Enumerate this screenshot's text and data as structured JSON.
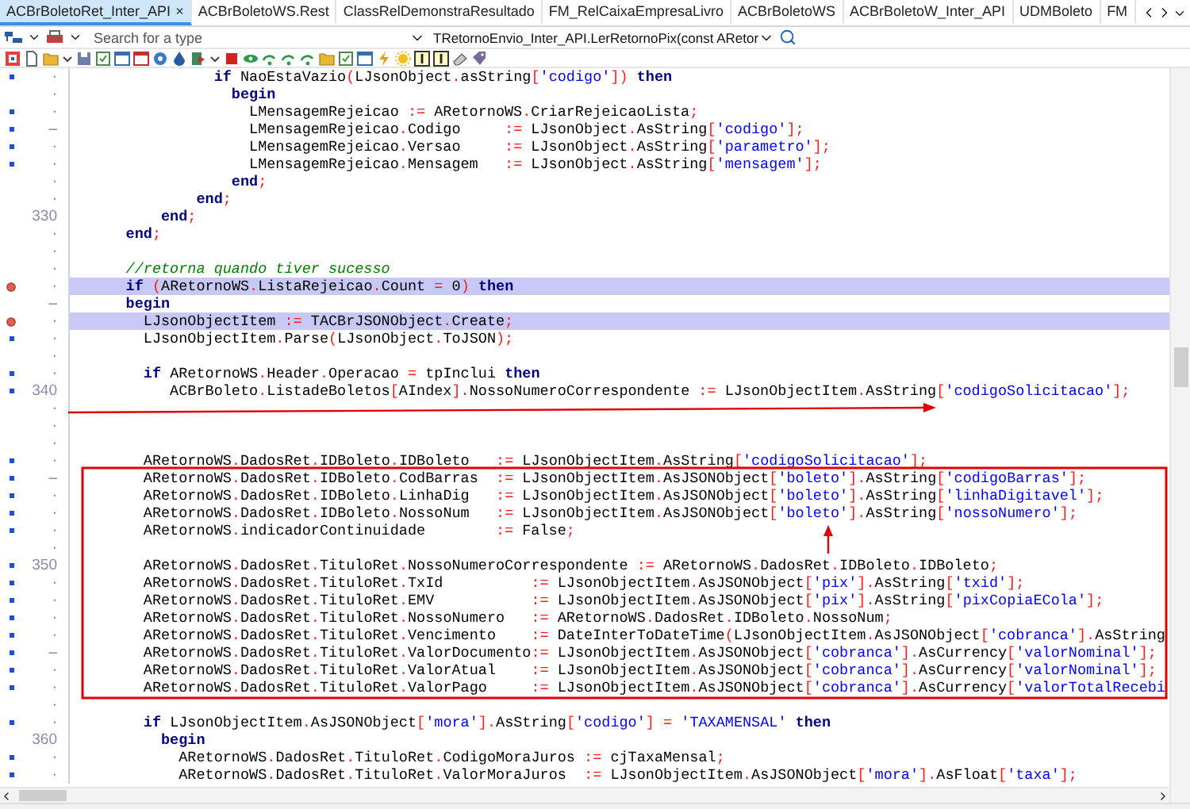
{
  "tabs": [
    {
      "label": "ACBrBoletoRet_Inter_API",
      "selected": true,
      "close": "×"
    },
    {
      "label": "ACBrBoletoWS.Rest",
      "selected": false
    },
    {
      "label": "ClassRelDemonstraResultado",
      "selected": false
    },
    {
      "label": "FM_RelCaixaEmpresaLivro",
      "selected": false
    },
    {
      "label": "ACBrBoletoWS",
      "selected": false
    },
    {
      "label": "ACBrBoletoW_Inter_API",
      "selected": false
    },
    {
      "label": "UDMBoleto",
      "selected": false
    },
    {
      "label": "FM",
      "selected": false
    }
  ],
  "nav": {
    "search_placeholder": "Search for a type",
    "method": "TRetornoEnvio_Inter_API.LerRetornoPix(const ARetor"
  },
  "editor": {
    "lines": [
      {
        "gutter": "·",
        "exec": true,
        "breakpoint": false,
        "highlighted": false,
        "code": [
          {
            "kind": "kw",
            "text": "                if"
          },
          {
            "kind": "id",
            "text": " NaoEstaVazio"
          },
          {
            "kind": "sym",
            "text": "("
          },
          {
            "kind": "id",
            "text": "LJsonObject"
          },
          {
            "kind": "sym",
            "text": "."
          },
          {
            "kind": "id",
            "text": "asString"
          },
          {
            "kind": "sym",
            "text": "["
          },
          {
            "kind": "str",
            "text": "'codigo'"
          },
          {
            "kind": "sym",
            "text": "])"
          },
          {
            "kind": "kw",
            "text": " then"
          }
        ]
      },
      {
        "gutter": "·",
        "exec": false,
        "breakpoint": false,
        "highlighted": false,
        "code": [
          {
            "kind": "kw",
            "text": "                  begin"
          }
        ]
      },
      {
        "gutter": "·",
        "exec": true,
        "breakpoint": false,
        "highlighted": false,
        "code": [
          {
            "kind": "id",
            "text": "                    LMensagemRejeicao "
          },
          {
            "kind": "sym",
            "text": ":="
          },
          {
            "kind": "id",
            "text": " ARetornoWS"
          },
          {
            "kind": "sym",
            "text": "."
          },
          {
            "kind": "id",
            "text": "CriarRejeicaoLista"
          },
          {
            "kind": "sym",
            "text": ";"
          }
        ]
      },
      {
        "gutter": "–",
        "exec": true,
        "breakpoint": false,
        "highlighted": false,
        "code": [
          {
            "kind": "id",
            "text": "                    LMensagemRejeicao"
          },
          {
            "kind": "sym",
            "text": "."
          },
          {
            "kind": "id",
            "text": "Codigo     "
          },
          {
            "kind": "sym",
            "text": ":="
          },
          {
            "kind": "id",
            "text": " LJsonObject"
          },
          {
            "kind": "sym",
            "text": "."
          },
          {
            "kind": "id",
            "text": "AsString"
          },
          {
            "kind": "sym",
            "text": "["
          },
          {
            "kind": "str",
            "text": "'codigo'"
          },
          {
            "kind": "sym",
            "text": "];"
          }
        ]
      },
      {
        "gutter": "·",
        "exec": true,
        "breakpoint": false,
        "highlighted": false,
        "code": [
          {
            "kind": "id",
            "text": "                    LMensagemRejeicao"
          },
          {
            "kind": "sym",
            "text": "."
          },
          {
            "kind": "id",
            "text": "Versao     "
          },
          {
            "kind": "sym",
            "text": ":="
          },
          {
            "kind": "id",
            "text": " LJsonObject"
          },
          {
            "kind": "sym",
            "text": "."
          },
          {
            "kind": "id",
            "text": "AsString"
          },
          {
            "kind": "sym",
            "text": "["
          },
          {
            "kind": "str",
            "text": "'parametro'"
          },
          {
            "kind": "sym",
            "text": "];"
          }
        ]
      },
      {
        "gutter": "·",
        "exec": true,
        "breakpoint": false,
        "highlighted": false,
        "code": [
          {
            "kind": "id",
            "text": "                    LMensagemRejeicao"
          },
          {
            "kind": "sym",
            "text": "."
          },
          {
            "kind": "id",
            "text": "Mensagem   "
          },
          {
            "kind": "sym",
            "text": ":="
          },
          {
            "kind": "id",
            "text": " LJsonObject"
          },
          {
            "kind": "sym",
            "text": "."
          },
          {
            "kind": "id",
            "text": "AsString"
          },
          {
            "kind": "sym",
            "text": "["
          },
          {
            "kind": "str",
            "text": "'mensagem'"
          },
          {
            "kind": "sym",
            "text": "];"
          }
        ]
      },
      {
        "gutter": "·",
        "exec": false,
        "breakpoint": false,
        "highlighted": false,
        "code": [
          {
            "kind": "kw",
            "text": "                  end"
          },
          {
            "kind": "sym",
            "text": ";"
          }
        ]
      },
      {
        "gutter": "·",
        "exec": false,
        "breakpoint": false,
        "highlighted": false,
        "code": [
          {
            "kind": "kw",
            "text": "              end"
          },
          {
            "kind": "sym",
            "text": ";"
          }
        ]
      },
      {
        "gutter": "330",
        "exec": false,
        "breakpoint": false,
        "highlighted": false,
        "code": [
          {
            "kind": "kw",
            "text": "          end"
          },
          {
            "kind": "sym",
            "text": ";"
          }
        ]
      },
      {
        "gutter": "·",
        "exec": false,
        "breakpoint": false,
        "highlighted": false,
        "code": [
          {
            "kind": "kw",
            "text": "      end"
          },
          {
            "kind": "sym",
            "text": ";"
          }
        ]
      },
      {
        "gutter": "·",
        "exec": false,
        "breakpoint": false,
        "highlighted": false
      },
      {
        "gutter": "·",
        "exec": false,
        "breakpoint": false,
        "highlighted": false,
        "code": [
          {
            "kind": "cmt",
            "text": "      //retorna quando tiver sucesso"
          }
        ]
      },
      {
        "gutter": "·",
        "breakpoint": true,
        "highlighted": true,
        "code": [
          {
            "kind": "kw",
            "text": "      if"
          },
          {
            "kind": "sym",
            "text": " ("
          },
          {
            "kind": "id",
            "text": "ARetornoWS"
          },
          {
            "kind": "sym",
            "text": "."
          },
          {
            "kind": "id",
            "text": "ListaRejeicao"
          },
          {
            "kind": "sym",
            "text": "."
          },
          {
            "kind": "id",
            "text": "Count "
          },
          {
            "kind": "sym",
            "text": "="
          },
          {
            "kind": "id",
            "text": " 0"
          },
          {
            "kind": "sym",
            "text": ")"
          },
          {
            "kind": "kw",
            "text": " then"
          }
        ]
      },
      {
        "gutter": "–",
        "exec": false,
        "breakpoint": false,
        "highlighted": false,
        "code": [
          {
            "kind": "kw",
            "text": "      begin"
          }
        ]
      },
      {
        "gutter": "·",
        "breakpoint": true,
        "highlighted": true,
        "code": [
          {
            "kind": "id",
            "text": "        LJsonObjectItem "
          },
          {
            "kind": "sym",
            "text": ":="
          },
          {
            "kind": "id",
            "text": " TACBrJSONObject"
          },
          {
            "kind": "sym",
            "text": "."
          },
          {
            "kind": "id",
            "text": "Create"
          },
          {
            "kind": "sym",
            "text": ";"
          }
        ]
      },
      {
        "gutter": "·",
        "exec": true,
        "breakpoint": false,
        "highlighted": false,
        "code": [
          {
            "kind": "id",
            "text": "        LJsonObjectItem"
          },
          {
            "kind": "sym",
            "text": "."
          },
          {
            "kind": "id",
            "text": "Parse"
          },
          {
            "kind": "sym",
            "text": "("
          },
          {
            "kind": "id",
            "text": "LJsonObject"
          },
          {
            "kind": "sym",
            "text": "."
          },
          {
            "kind": "id",
            "text": "ToJSON"
          },
          {
            "kind": "sym",
            "text": ");"
          }
        ]
      },
      {
        "gutter": "·",
        "exec": false,
        "breakpoint": false,
        "highlighted": false
      },
      {
        "gutter": "·",
        "exec": true,
        "breakpoint": false,
        "highlighted": false,
        "code": [
          {
            "kind": "kw",
            "text": "        if"
          },
          {
            "kind": "id",
            "text": " ARetornoWS"
          },
          {
            "kind": "sym",
            "text": "."
          },
          {
            "kind": "id",
            "text": "Header"
          },
          {
            "kind": "sym",
            "text": "."
          },
          {
            "kind": "id",
            "text": "Operacao "
          },
          {
            "kind": "sym",
            "text": "="
          },
          {
            "kind": "id",
            "text": " tpInclui"
          },
          {
            "kind": "kw",
            "text": " then"
          }
        ]
      },
      {
        "gutter": "340",
        "exec": true,
        "breakpoint": false,
        "highlighted": false,
        "code": [
          {
            "kind": "id",
            "text": "           ACBrBoleto"
          },
          {
            "kind": "sym",
            "text": "."
          },
          {
            "kind": "id",
            "text": "ListadeBoletos"
          },
          {
            "kind": "sym",
            "text": "["
          },
          {
            "kind": "id",
            "text": "AIndex"
          },
          {
            "kind": "sym",
            "text": "]."
          },
          {
            "kind": "id",
            "text": "NossoNumeroCorrespondente "
          },
          {
            "kind": "sym",
            "text": ":="
          },
          {
            "kind": "id",
            "text": " LJsonObjectItem"
          },
          {
            "kind": "sym",
            "text": "."
          },
          {
            "kind": "id",
            "text": "AsString"
          },
          {
            "kind": "sym",
            "text": "["
          },
          {
            "kind": "str",
            "text": "'codigoSolicitacao'"
          },
          {
            "kind": "sym",
            "text": "];"
          }
        ]
      },
      {
        "gutter": "·",
        "exec": false,
        "breakpoint": false,
        "highlighted": false
      },
      {
        "gutter": "·",
        "exec": false,
        "breakpoint": false,
        "highlighted": false
      },
      {
        "gutter": "·",
        "exec": false,
        "breakpoint": false,
        "highlighted": false
      },
      {
        "gutter": "·",
        "exec": true,
        "breakpoint": false,
        "highlighted": false,
        "code": [
          {
            "kind": "id",
            "text": "        ARetornoWS"
          },
          {
            "kind": "sym",
            "text": "."
          },
          {
            "kind": "id",
            "text": "DadosRet"
          },
          {
            "kind": "sym",
            "text": "."
          },
          {
            "kind": "id",
            "text": "IDBoleto"
          },
          {
            "kind": "sym",
            "text": "."
          },
          {
            "kind": "id",
            "text": "IDBoleto   "
          },
          {
            "kind": "sym",
            "text": ":="
          },
          {
            "kind": "id",
            "text": " LJsonObjectItem"
          },
          {
            "kind": "sym",
            "text": "."
          },
          {
            "kind": "id",
            "text": "AsString"
          },
          {
            "kind": "sym",
            "text": "["
          },
          {
            "kind": "str",
            "text": "'codigoSolicitacao'"
          },
          {
            "kind": "sym",
            "text": "];"
          }
        ]
      },
      {
        "gutter": "–",
        "exec": true,
        "breakpoint": false,
        "highlighted": false,
        "code": [
          {
            "kind": "id",
            "text": "        ARetornoWS"
          },
          {
            "kind": "sym",
            "text": "."
          },
          {
            "kind": "id",
            "text": "DadosRet"
          },
          {
            "kind": "sym",
            "text": "."
          },
          {
            "kind": "id",
            "text": "IDBoleto"
          },
          {
            "kind": "sym",
            "text": "."
          },
          {
            "kind": "id",
            "text": "CodBarras  "
          },
          {
            "kind": "sym",
            "text": ":="
          },
          {
            "kind": "id",
            "text": " LJsonObjectItem"
          },
          {
            "kind": "sym",
            "text": "."
          },
          {
            "kind": "id",
            "text": "AsJSONObject"
          },
          {
            "kind": "sym",
            "text": "["
          },
          {
            "kind": "str",
            "text": "'boleto'"
          },
          {
            "kind": "sym",
            "text": "]."
          },
          {
            "kind": "id",
            "text": "AsString"
          },
          {
            "kind": "sym",
            "text": "["
          },
          {
            "kind": "str",
            "text": "'codigoBarras'"
          },
          {
            "kind": "sym",
            "text": "];"
          }
        ]
      },
      {
        "gutter": "·",
        "exec": true,
        "breakpoint": false,
        "highlighted": false,
        "code": [
          {
            "kind": "id",
            "text": "        ARetornoWS"
          },
          {
            "kind": "sym",
            "text": "."
          },
          {
            "kind": "id",
            "text": "DadosRet"
          },
          {
            "kind": "sym",
            "text": "."
          },
          {
            "kind": "id",
            "text": "IDBoleto"
          },
          {
            "kind": "sym",
            "text": "."
          },
          {
            "kind": "id",
            "text": "LinhaDig   "
          },
          {
            "kind": "sym",
            "text": ":="
          },
          {
            "kind": "id",
            "text": " LJsonObjectItem"
          },
          {
            "kind": "sym",
            "text": "."
          },
          {
            "kind": "id",
            "text": "AsJSONObject"
          },
          {
            "kind": "sym",
            "text": "["
          },
          {
            "kind": "str",
            "text": "'boleto'"
          },
          {
            "kind": "sym",
            "text": "]."
          },
          {
            "kind": "id",
            "text": "AsString"
          },
          {
            "kind": "sym",
            "text": "["
          },
          {
            "kind": "str",
            "text": "'linhaDigitavel'"
          },
          {
            "kind": "sym",
            "text": "];"
          }
        ]
      },
      {
        "gutter": "·",
        "exec": true,
        "breakpoint": false,
        "highlighted": false,
        "code": [
          {
            "kind": "id",
            "text": "        ARetornoWS"
          },
          {
            "kind": "sym",
            "text": "."
          },
          {
            "kind": "id",
            "text": "DadosRet"
          },
          {
            "kind": "sym",
            "text": "."
          },
          {
            "kind": "id",
            "text": "IDBoleto"
          },
          {
            "kind": "sym",
            "text": "."
          },
          {
            "kind": "id",
            "text": "NossoNum   "
          },
          {
            "kind": "sym",
            "text": ":="
          },
          {
            "kind": "id",
            "text": " LJsonObjectItem"
          },
          {
            "kind": "sym",
            "text": "."
          },
          {
            "kind": "id",
            "text": "AsJSONObject"
          },
          {
            "kind": "sym",
            "text": "["
          },
          {
            "kind": "str",
            "text": "'boleto'"
          },
          {
            "kind": "sym",
            "text": "]."
          },
          {
            "kind": "id",
            "text": "AsString"
          },
          {
            "kind": "sym",
            "text": "["
          },
          {
            "kind": "str",
            "text": "'nossoNumero'"
          },
          {
            "kind": "sym",
            "text": "];"
          }
        ]
      },
      {
        "gutter": "·",
        "exec": true,
        "breakpoint": false,
        "highlighted": false,
        "code": [
          {
            "kind": "id",
            "text": "        ARetornoWS"
          },
          {
            "kind": "sym",
            "text": "."
          },
          {
            "kind": "id",
            "text": "indicadorContinuidade        "
          },
          {
            "kind": "sym",
            "text": ":="
          },
          {
            "kind": "id",
            "text": " False"
          },
          {
            "kind": "sym",
            "text": ";"
          }
        ]
      },
      {
        "gutter": "·",
        "exec": false,
        "breakpoint": false,
        "highlighted": false
      },
      {
        "gutter": "350",
        "exec": true,
        "breakpoint": false,
        "highlighted": false,
        "code": [
          {
            "kind": "id",
            "text": "        ARetornoWS"
          },
          {
            "kind": "sym",
            "text": "."
          },
          {
            "kind": "id",
            "text": "DadosRet"
          },
          {
            "kind": "sym",
            "text": "."
          },
          {
            "kind": "id",
            "text": "TituloRet"
          },
          {
            "kind": "sym",
            "text": "."
          },
          {
            "kind": "id",
            "text": "NossoNumeroCorrespondente "
          },
          {
            "kind": "sym",
            "text": ":="
          },
          {
            "kind": "id",
            "text": " ARetornoWS"
          },
          {
            "kind": "sym",
            "text": "."
          },
          {
            "kind": "id",
            "text": "DadosRet"
          },
          {
            "kind": "sym",
            "text": "."
          },
          {
            "kind": "id",
            "text": "IDBoleto"
          },
          {
            "kind": "sym",
            "text": "."
          },
          {
            "kind": "id",
            "text": "IDBoleto"
          },
          {
            "kind": "sym",
            "text": ";"
          }
        ]
      },
      {
        "gutter": "·",
        "exec": true,
        "breakpoint": false,
        "highlighted": false,
        "code": [
          {
            "kind": "id",
            "text": "        ARetornoWS"
          },
          {
            "kind": "sym",
            "text": "."
          },
          {
            "kind": "id",
            "text": "DadosRet"
          },
          {
            "kind": "sym",
            "text": "."
          },
          {
            "kind": "id",
            "text": "TituloRet"
          },
          {
            "kind": "sym",
            "text": "."
          },
          {
            "kind": "id",
            "text": "TxId          "
          },
          {
            "kind": "sym",
            "text": ":="
          },
          {
            "kind": "id",
            "text": " LJsonObjectItem"
          },
          {
            "kind": "sym",
            "text": "."
          },
          {
            "kind": "id",
            "text": "AsJSONObject"
          },
          {
            "kind": "sym",
            "text": "["
          },
          {
            "kind": "str",
            "text": "'pix'"
          },
          {
            "kind": "sym",
            "text": "]."
          },
          {
            "kind": "id",
            "text": "AsString"
          },
          {
            "kind": "sym",
            "text": "["
          },
          {
            "kind": "str",
            "text": "'txid'"
          },
          {
            "kind": "sym",
            "text": "];"
          }
        ]
      },
      {
        "gutter": "·",
        "exec": true,
        "breakpoint": false,
        "highlighted": false,
        "code": [
          {
            "kind": "id",
            "text": "        ARetornoWS"
          },
          {
            "kind": "sym",
            "text": "."
          },
          {
            "kind": "id",
            "text": "DadosRet"
          },
          {
            "kind": "sym",
            "text": "."
          },
          {
            "kind": "id",
            "text": "TituloRet"
          },
          {
            "kind": "sym",
            "text": "."
          },
          {
            "kind": "id",
            "text": "EMV           "
          },
          {
            "kind": "sym",
            "text": ":="
          },
          {
            "kind": "id",
            "text": " LJsonObjectItem"
          },
          {
            "kind": "sym",
            "text": "."
          },
          {
            "kind": "id",
            "text": "AsJSONObject"
          },
          {
            "kind": "sym",
            "text": "["
          },
          {
            "kind": "str",
            "text": "'pix'"
          },
          {
            "kind": "sym",
            "text": "]."
          },
          {
            "kind": "id",
            "text": "AsString"
          },
          {
            "kind": "sym",
            "text": "["
          },
          {
            "kind": "str",
            "text": "'pixCopiaECola'"
          },
          {
            "kind": "sym",
            "text": "];"
          }
        ]
      },
      {
        "gutter": "·",
        "exec": true,
        "breakpoint": false,
        "highlighted": false,
        "code": [
          {
            "kind": "id",
            "text": "        ARetornoWS"
          },
          {
            "kind": "sym",
            "text": "."
          },
          {
            "kind": "id",
            "text": "DadosRet"
          },
          {
            "kind": "sym",
            "text": "."
          },
          {
            "kind": "id",
            "text": "TituloRet"
          },
          {
            "kind": "sym",
            "text": "."
          },
          {
            "kind": "id",
            "text": "NossoNumero   "
          },
          {
            "kind": "sym",
            "text": ":="
          },
          {
            "kind": "id",
            "text": " ARetornoWS"
          },
          {
            "kind": "sym",
            "text": "."
          },
          {
            "kind": "id",
            "text": "DadosRet"
          },
          {
            "kind": "sym",
            "text": "."
          },
          {
            "kind": "id",
            "text": "IDBoleto"
          },
          {
            "kind": "sym",
            "text": "."
          },
          {
            "kind": "id",
            "text": "NossoNum"
          },
          {
            "kind": "sym",
            "text": ";"
          }
        ]
      },
      {
        "gutter": "·",
        "exec": true,
        "breakpoint": false,
        "highlighted": false,
        "code": [
          {
            "kind": "id",
            "text": "        ARetornoWS"
          },
          {
            "kind": "sym",
            "text": "."
          },
          {
            "kind": "id",
            "text": "DadosRet"
          },
          {
            "kind": "sym",
            "text": "."
          },
          {
            "kind": "id",
            "text": "TituloRet"
          },
          {
            "kind": "sym",
            "text": "."
          },
          {
            "kind": "id",
            "text": "Vencimento    "
          },
          {
            "kind": "sym",
            "text": ":="
          },
          {
            "kind": "id",
            "text": " DateInterToDateTime"
          },
          {
            "kind": "sym",
            "text": "("
          },
          {
            "kind": "id",
            "text": "LJsonObjectItem"
          },
          {
            "kind": "sym",
            "text": "."
          },
          {
            "kind": "id",
            "text": "AsJSONObject"
          },
          {
            "kind": "sym",
            "text": "["
          },
          {
            "kind": "str",
            "text": "'cobranca'"
          },
          {
            "kind": "sym",
            "text": "]."
          },
          {
            "kind": "id",
            "text": "AsString"
          }
        ]
      },
      {
        "gutter": "–",
        "exec": true,
        "breakpoint": false,
        "highlighted": false,
        "code": [
          {
            "kind": "id",
            "text": "        ARetornoWS"
          },
          {
            "kind": "sym",
            "text": "."
          },
          {
            "kind": "id",
            "text": "DadosRet"
          },
          {
            "kind": "sym",
            "text": "."
          },
          {
            "kind": "id",
            "text": "TituloRet"
          },
          {
            "kind": "sym",
            "text": "."
          },
          {
            "kind": "id",
            "text": "ValorDocumento"
          },
          {
            "kind": "sym",
            "text": ":="
          },
          {
            "kind": "id",
            "text": " LJsonObjectItem"
          },
          {
            "kind": "sym",
            "text": "."
          },
          {
            "kind": "id",
            "text": "AsJSONObject"
          },
          {
            "kind": "sym",
            "text": "["
          },
          {
            "kind": "str",
            "text": "'cobranca'"
          },
          {
            "kind": "sym",
            "text": "]."
          },
          {
            "kind": "id",
            "text": "AsCurrency"
          },
          {
            "kind": "sym",
            "text": "["
          },
          {
            "kind": "str",
            "text": "'valorNominal'"
          },
          {
            "kind": "sym",
            "text": "];"
          }
        ]
      },
      {
        "gutter": "·",
        "exec": true,
        "breakpoint": false,
        "highlighted": false,
        "code": [
          {
            "kind": "id",
            "text": "        ARetornoWS"
          },
          {
            "kind": "sym",
            "text": "."
          },
          {
            "kind": "id",
            "text": "DadosRet"
          },
          {
            "kind": "sym",
            "text": "."
          },
          {
            "kind": "id",
            "text": "TituloRet"
          },
          {
            "kind": "sym",
            "text": "."
          },
          {
            "kind": "id",
            "text": "ValorAtual    "
          },
          {
            "kind": "sym",
            "text": ":="
          },
          {
            "kind": "id",
            "text": " LJsonObjectItem"
          },
          {
            "kind": "sym",
            "text": "."
          },
          {
            "kind": "id",
            "text": "AsJSONObject"
          },
          {
            "kind": "sym",
            "text": "["
          },
          {
            "kind": "str",
            "text": "'cobranca'"
          },
          {
            "kind": "sym",
            "text": "]."
          },
          {
            "kind": "id",
            "text": "AsCurrency"
          },
          {
            "kind": "sym",
            "text": "["
          },
          {
            "kind": "str",
            "text": "'valorNominal'"
          },
          {
            "kind": "sym",
            "text": "];"
          }
        ]
      },
      {
        "gutter": "·",
        "exec": true,
        "breakpoint": false,
        "highlighted": false,
        "code": [
          {
            "kind": "id",
            "text": "        ARetornoWS"
          },
          {
            "kind": "sym",
            "text": "."
          },
          {
            "kind": "id",
            "text": "DadosRet"
          },
          {
            "kind": "sym",
            "text": "."
          },
          {
            "kind": "id",
            "text": "TituloRet"
          },
          {
            "kind": "sym",
            "text": "."
          },
          {
            "kind": "id",
            "text": "ValorPago     "
          },
          {
            "kind": "sym",
            "text": ":="
          },
          {
            "kind": "id",
            "text": " LJsonObjectItem"
          },
          {
            "kind": "sym",
            "text": "."
          },
          {
            "kind": "id",
            "text": "AsJSONObject"
          },
          {
            "kind": "sym",
            "text": "["
          },
          {
            "kind": "str",
            "text": "'cobranca'"
          },
          {
            "kind": "sym",
            "text": "]."
          },
          {
            "kind": "id",
            "text": "AsCurrency"
          },
          {
            "kind": "sym",
            "text": "["
          },
          {
            "kind": "str",
            "text": "'valorTotalRecebi"
          }
        ]
      },
      {
        "gutter": "·",
        "exec": false,
        "breakpoint": false,
        "highlighted": false
      },
      {
        "gutter": "·",
        "exec": true,
        "breakpoint": false,
        "highlighted": false,
        "code": [
          {
            "kind": "kw",
            "text": "        if"
          },
          {
            "kind": "id",
            "text": " LJsonObjectItem"
          },
          {
            "kind": "sym",
            "text": "."
          },
          {
            "kind": "id",
            "text": "AsJSONObject"
          },
          {
            "kind": "sym",
            "text": "["
          },
          {
            "kind": "str",
            "text": "'mora'"
          },
          {
            "kind": "sym",
            "text": "]."
          },
          {
            "kind": "id",
            "text": "AsString"
          },
          {
            "kind": "sym",
            "text": "["
          },
          {
            "kind": "str",
            "text": "'codigo'"
          },
          {
            "kind": "sym",
            "text": "] = "
          },
          {
            "kind": "str",
            "text": "'TAXAMENSAL'"
          },
          {
            "kind": "kw",
            "text": " then"
          }
        ]
      },
      {
        "gutter": "360",
        "exec": false,
        "breakpoint": false,
        "highlighted": false,
        "code": [
          {
            "kind": "kw",
            "text": "          begin"
          }
        ]
      },
      {
        "gutter": "·",
        "exec": true,
        "breakpoint": false,
        "highlighted": false,
        "code": [
          {
            "kind": "id",
            "text": "            ARetornoWS"
          },
          {
            "kind": "sym",
            "text": "."
          },
          {
            "kind": "id",
            "text": "DadosRet"
          },
          {
            "kind": "sym",
            "text": "."
          },
          {
            "kind": "id",
            "text": "TituloRet"
          },
          {
            "kind": "sym",
            "text": "."
          },
          {
            "kind": "id",
            "text": "CodigoMoraJuros "
          },
          {
            "kind": "sym",
            "text": ":="
          },
          {
            "kind": "id",
            "text": " cjTaxaMensal"
          },
          {
            "kind": "sym",
            "text": ";"
          }
        ]
      },
      {
        "gutter": "·",
        "exec": true,
        "breakpoint": false,
        "highlighted": false,
        "code": [
          {
            "kind": "id",
            "text": "            ARetornoWS"
          },
          {
            "kind": "sym",
            "text": "."
          },
          {
            "kind": "id",
            "text": "DadosRet"
          },
          {
            "kind": "sym",
            "text": "."
          },
          {
            "kind": "id",
            "text": "TituloRet"
          },
          {
            "kind": "sym",
            "text": "."
          },
          {
            "kind": "id",
            "text": "ValorMoraJuros  "
          },
          {
            "kind": "sym",
            "text": ":="
          },
          {
            "kind": "id",
            "text": " LJsonObjectItem"
          },
          {
            "kind": "sym",
            "text": "."
          },
          {
            "kind": "id",
            "text": "AsJSONObject"
          },
          {
            "kind": "sym",
            "text": "["
          },
          {
            "kind": "str",
            "text": "'mora'"
          },
          {
            "kind": "sym",
            "text": "]."
          },
          {
            "kind": "id",
            "text": "AsFloat"
          },
          {
            "kind": "sym",
            "text": "["
          },
          {
            "kind": "str",
            "text": "'taxa'"
          },
          {
            "kind": "sym",
            "text": "];"
          }
        ]
      }
    ]
  }
}
